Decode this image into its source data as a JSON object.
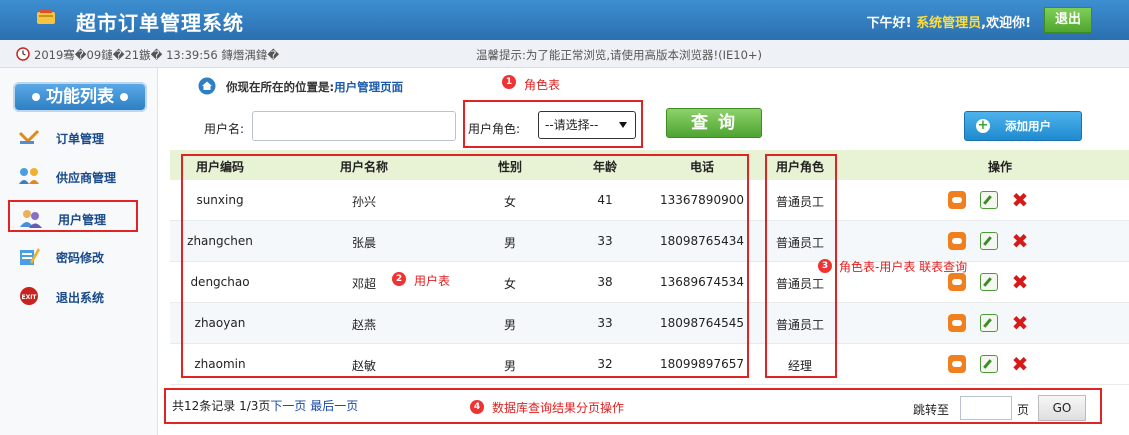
{
  "header": {
    "title": "超市订单管理系统",
    "greeting_prefix": "下午好!",
    "role": "系统管理员",
    "greeting_suffix": ",欢迎你!",
    "logout_label": "退出"
  },
  "infobar": {
    "time": "2019骞�09鏈�21鏃� 13:39:56 鏄熸湡鍏�",
    "tip": "温馨提示:为了能正常浏览,请使用高版本浏览器!(IE10+)"
  },
  "sidebar": {
    "title": "功能列表",
    "items": [
      {
        "label": "订单管理",
        "icon": "order-icon"
      },
      {
        "label": "供应商管理",
        "icon": "supplier-icon"
      },
      {
        "label": "用户管理",
        "icon": "user-icon",
        "active": true
      },
      {
        "label": "密码修改",
        "icon": "password-icon"
      },
      {
        "label": "退出系统",
        "icon": "exit-icon"
      }
    ]
  },
  "breadcrumb": {
    "prefix": "你现在所在的位置是:",
    "page": "用户管理页面"
  },
  "search": {
    "name_label": "用户名:",
    "name_value": "",
    "role_label": "用户角色:",
    "role_value": "--请选择--",
    "query_label": "查 询",
    "add_label": "添加用户"
  },
  "table": {
    "headers": [
      "用户编码",
      "用户名称",
      "性别",
      "年龄",
      "电话",
      "用户角色",
      "操作"
    ],
    "rows": [
      [
        "sunxing",
        "孙兴",
        "女",
        "41",
        "13367890900",
        "普通员工"
      ],
      [
        "zhangchen",
        "张晨",
        "男",
        "33",
        "18098765434",
        "普通员工"
      ],
      [
        "dengchao",
        "邓超",
        "女",
        "38",
        "13689674534",
        "普通员工"
      ],
      [
        "zhaoyan",
        "赵燕",
        "男",
        "33",
        "18098764545",
        "普通员工"
      ],
      [
        "zhaomin",
        "赵敏",
        "男",
        "32",
        "18099897657",
        "经理"
      ]
    ]
  },
  "pagination": {
    "summary": "共12条记录  1/3页",
    "next": "下一页",
    "last": "最后一页",
    "jump_label": "跳转至",
    "jump_value": "",
    "page_unit": "页",
    "go_label": "GO"
  },
  "annotations": [
    {
      "num": "1",
      "text": "角色表"
    },
    {
      "num": "2",
      "text": "用户表"
    },
    {
      "num": "3",
      "text": "角色表-用户表 联表查询"
    },
    {
      "num": "4",
      "text": "数据库查询结果分页操作"
    }
  ],
  "colors": {
    "header_bg": "#2b6fb0",
    "role_highlight": "#ffde3c",
    "annotation_red": "#e02424",
    "table_header_bg": "#e8f2d4"
  }
}
